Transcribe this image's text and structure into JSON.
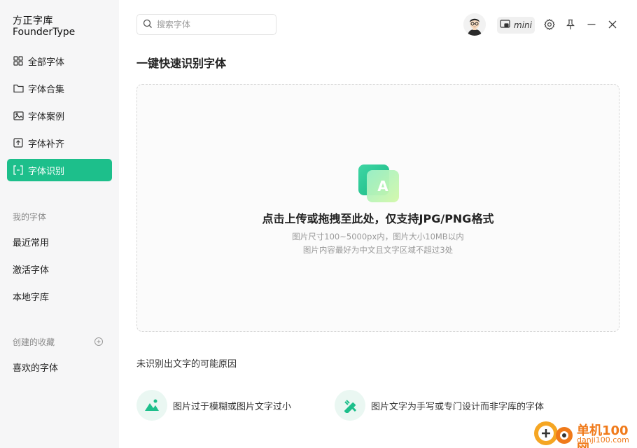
{
  "app": {
    "logo_line1": "方正字库",
    "logo_line2": "FounderType"
  },
  "sidebar": {
    "nav": [
      {
        "label": "全部字体",
        "icon": "grid-icon"
      },
      {
        "label": "字体合集",
        "icon": "folder-icon"
      },
      {
        "label": "字体案例",
        "icon": "image-icon"
      },
      {
        "label": "字体补齐",
        "icon": "font-fill-icon"
      },
      {
        "label": "字体识别",
        "icon": "scan-text-icon",
        "active": true
      }
    ],
    "my_fonts_title": "我的字体",
    "my_fonts": [
      "最近常用",
      "激活字体",
      "本地字库"
    ],
    "collections_title": "创建的收藏",
    "collections": [
      "喜欢的字体"
    ]
  },
  "topbar": {
    "search_placeholder": "搜索字体",
    "mini_label": "mini"
  },
  "main": {
    "title": "一键快速识别字体",
    "upload_main": "点击上传或拖拽至此处，仅支持JPG/PNG格式",
    "upload_hint1": "图片尺寸100~5000px内，图片大小10MB以内",
    "upload_hint2": "图片内容最好为中文且文字区域不超过3处",
    "reasons_title": "未识别出文字的可能原因",
    "reasons": [
      {
        "label": "图片过于模糊或图片文字过小",
        "icon": "blurry-image-icon"
      },
      {
        "label": "图片文字为手写或专门设计而非字库的字体",
        "icon": "design-tools-icon"
      }
    ]
  },
  "watermark": {
    "text1": "单机100网",
    "text2": "danji100.com"
  },
  "colors": {
    "accent": "#1dbf8b",
    "accent_light": "#eaf7f2",
    "sidebar_bg": "#f6f6f7"
  }
}
